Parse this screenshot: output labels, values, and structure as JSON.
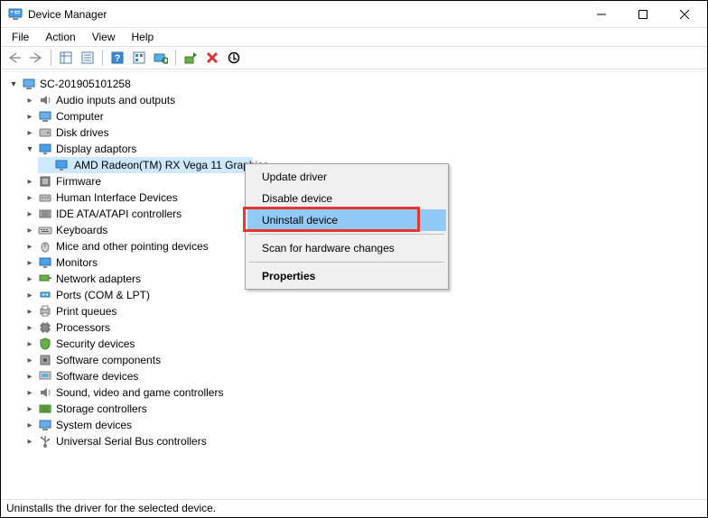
{
  "window": {
    "title": "Device Manager"
  },
  "menu": {
    "file": "File",
    "action": "Action",
    "view": "View",
    "help": "Help"
  },
  "tree": {
    "root": "SC-201905101258",
    "audio": "Audio inputs and outputs",
    "computer": "Computer",
    "disk": "Disk drives",
    "display": "Display adaptors",
    "display_child": "AMD Radeon(TM) RX Vega 11 Graphics",
    "firmware": "Firmware",
    "hid": "Human Interface Devices",
    "ide": "IDE ATA/ATAPI controllers",
    "keyboards": "Keyboards",
    "mice": "Mice and other pointing devices",
    "monitors": "Monitors",
    "network": "Network adapters",
    "ports": "Ports (COM & LPT)",
    "printq": "Print queues",
    "processors": "Processors",
    "security": "Security devices",
    "softcomp": "Software components",
    "softdev": "Software devices",
    "sound": "Sound, video and game controllers",
    "storage": "Storage controllers",
    "system": "System devices",
    "usb": "Universal Serial Bus controllers"
  },
  "context_menu": {
    "update": "Update driver",
    "disable": "Disable device",
    "uninstall": "Uninstall device",
    "scan": "Scan for hardware changes",
    "properties": "Properties"
  },
  "status": "Uninstalls the driver for the selected device."
}
